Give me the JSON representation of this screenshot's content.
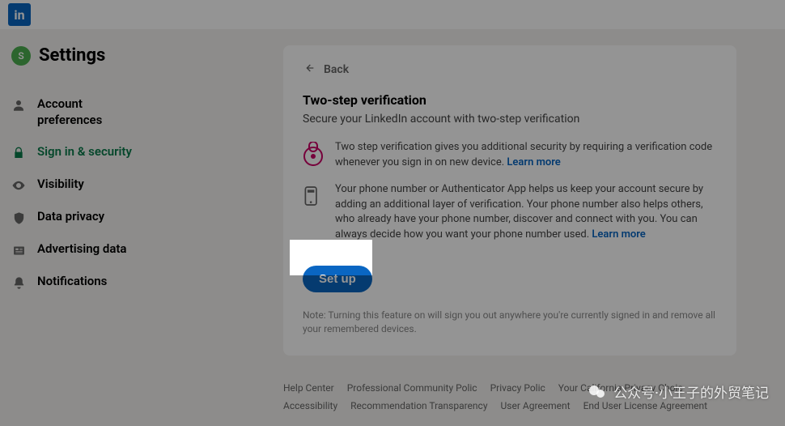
{
  "logo_text": "in",
  "sidebar": {
    "avatar_initial": "S",
    "title": "Settings",
    "items": [
      {
        "label": "Account preferences"
      },
      {
        "label": "Sign in & security"
      },
      {
        "label": "Visibility"
      },
      {
        "label": "Data privacy"
      },
      {
        "label": "Advertising data"
      },
      {
        "label": "Notifications"
      }
    ]
  },
  "content": {
    "back_label": "Back",
    "title": "Two-step verification",
    "subtitle": "Secure your LinkedIn account with two-step verification",
    "info1_text": "Two step verification gives you additional security by requiring a verification code whenever you sign in on new device. ",
    "info1_link": "Learn more",
    "info2_text": "Your phone number or Authenticator App helps us keep your account secure by adding an additional layer of verification. Your phone number also helps others, who already have your phone number, discover and connect with you. You can always decide how you want your phone number used. ",
    "info2_link": "Learn more",
    "setup_label": "Set up",
    "note": "Note: Turning this feature on will sign you out anywhere you're currently signed in and remove all your remembered devices."
  },
  "footer": {
    "row1": [
      "Help Center",
      "Professional Community Polic",
      "Privacy Polic",
      "Your California Privacy Choic"
    ],
    "row2": [
      "Accessibility",
      "Recommendation Transparency",
      "User Agreement",
      "End User License Agreement"
    ]
  },
  "watermark": "公众号·小王子的外贸笔记"
}
